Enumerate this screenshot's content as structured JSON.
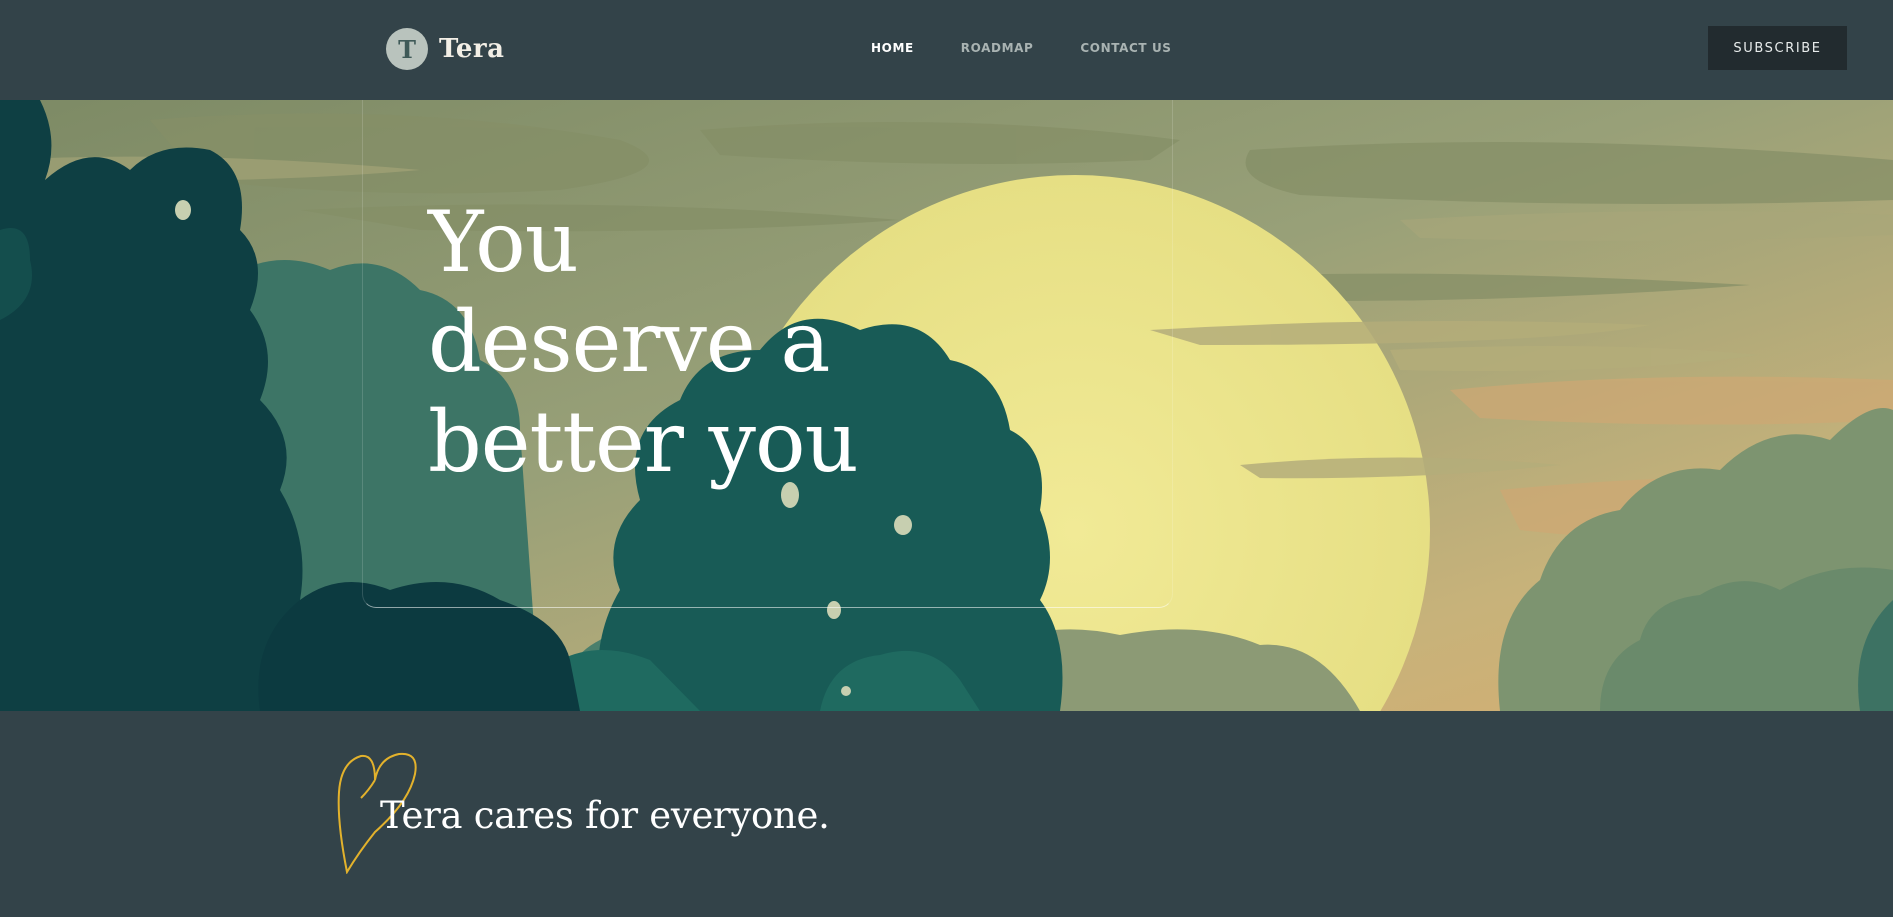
{
  "header": {
    "brand": {
      "logo_letter": "T",
      "name": "Tera"
    },
    "nav": [
      {
        "label": "HOME",
        "active": true
      },
      {
        "label": "ROADMAP",
        "active": false
      },
      {
        "label": "CONTACT US",
        "active": false
      }
    ],
    "subscribe_label": "SUBSCRIBE"
  },
  "hero": {
    "title_lines": [
      "You",
      "deserve a",
      "better you"
    ]
  },
  "section": {
    "tagline": "Tera cares for everyone."
  },
  "icons": {
    "logo": "tera-logo-icon",
    "heart": "heart-outline-icon"
  },
  "colors": {
    "header_bg": "#334349",
    "subscribe_bg": "#222b2f",
    "heart_stroke": "#e3b22c",
    "sky": "#8f9b73",
    "sun": "#ebe487",
    "foliage_dark": "#0e3f43"
  }
}
